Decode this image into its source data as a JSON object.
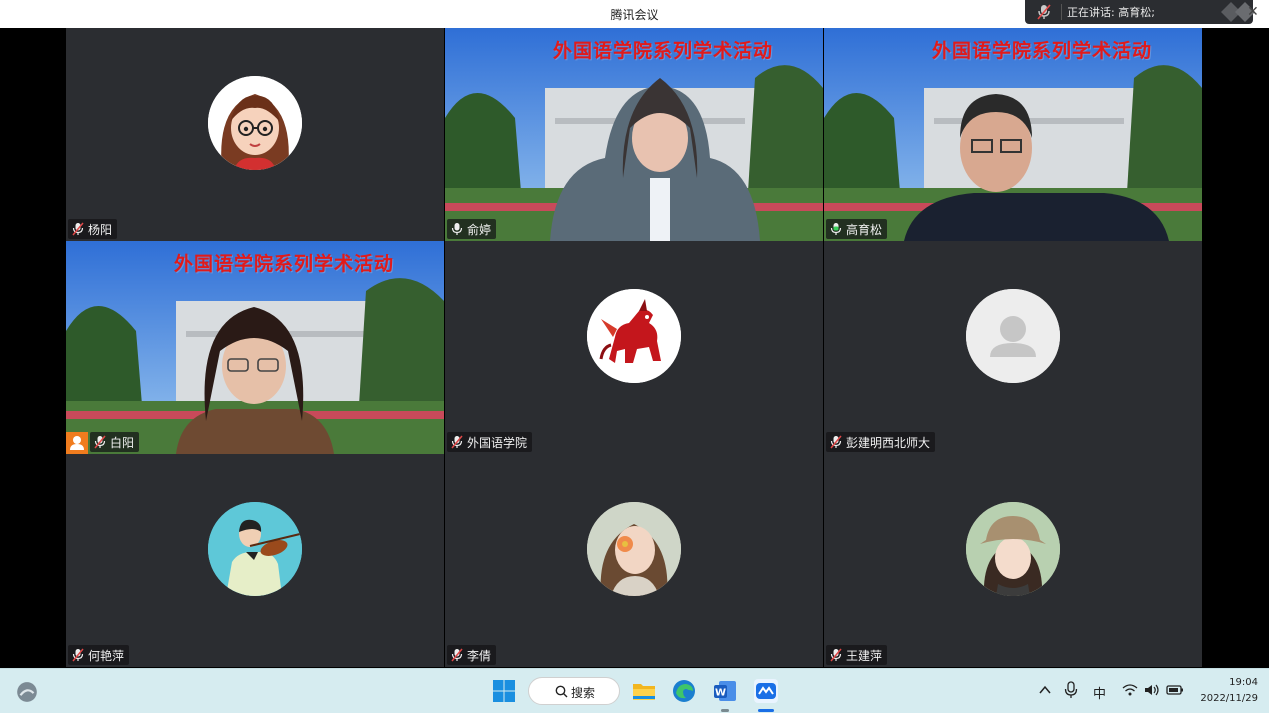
{
  "window": {
    "title": "腾讯会议"
  },
  "speaking_indicator": {
    "text": "正在讲话: 高育松;"
  },
  "participants": [
    {
      "name": "杨阳",
      "muted": true,
      "type": "avatar",
      "avatar": "cartoon-girl-glasses"
    },
    {
      "name": "俞婷",
      "muted": false,
      "type": "video",
      "banner": "外国语学院系列学术活动"
    },
    {
      "name": "高育松",
      "muted": false,
      "type": "video",
      "banner": "外国语学院系列学术活动",
      "active_speaker": true
    },
    {
      "name": "白阳",
      "muted": true,
      "type": "video",
      "banner": "外国语学院系列学术活动",
      "host": true
    },
    {
      "name": "外国语学院",
      "muted": true,
      "type": "avatar",
      "avatar": "red-qilin"
    },
    {
      "name": "彭建明西北师大",
      "muted": true,
      "type": "avatar",
      "avatar": "default-person"
    },
    {
      "name": "何艳萍",
      "muted": true,
      "type": "avatar",
      "avatar": "boy-violin"
    },
    {
      "name": "李倩",
      "muted": true,
      "type": "avatar",
      "avatar": "woman-flower"
    },
    {
      "name": "王建萍",
      "muted": true,
      "type": "avatar",
      "avatar": "woman-hat"
    }
  ],
  "taskbar": {
    "search_label": "搜索",
    "apps": [
      "start-icon",
      "search-icon",
      "file-explorer-icon",
      "edge-icon",
      "word-icon",
      "tencent-meeting-icon"
    ],
    "tray": {
      "ime": "中"
    },
    "clock": {
      "time": "19:04",
      "date": "2022/11/29"
    }
  },
  "colors": {
    "tile_bg": "#2b2d31",
    "active_border": "#3ad05a",
    "banner_red": "#e11a1a",
    "host_orange": "#f07c1e",
    "taskbar_bg": "#d6ecf0"
  }
}
